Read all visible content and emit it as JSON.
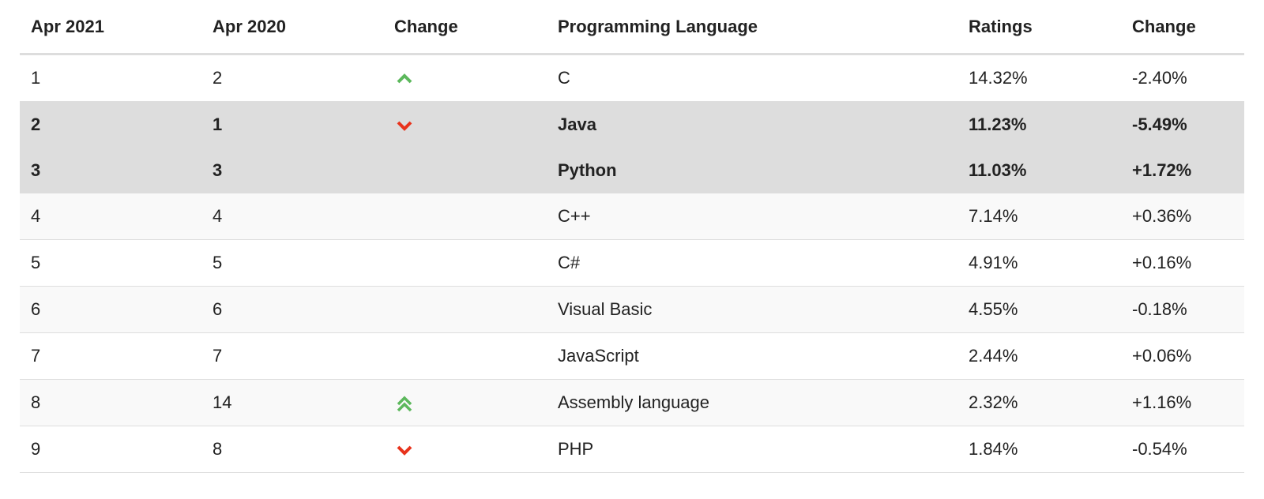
{
  "headers": [
    "Apr 2021",
    "Apr 2020",
    "Change",
    "Programming Language",
    "Ratings",
    "Change"
  ],
  "colors": {
    "up": "#5cb85c",
    "down": "#e8331c",
    "highlight": "#dddddd"
  },
  "rows": [
    {
      "apr2021": "1",
      "apr2020": "2",
      "change_icon": "chevron-up-icon",
      "language": "C",
      "ratings": "14.32%",
      "change": "-2.40%",
      "style": ""
    },
    {
      "apr2021": "2",
      "apr2020": "1",
      "change_icon": "chevron-down-icon",
      "language": "Java",
      "ratings": "11.23%",
      "change": "-5.49%",
      "style": "hl"
    },
    {
      "apr2021": "3",
      "apr2020": "3",
      "change_icon": "",
      "language": "Python",
      "ratings": "11.03%",
      "change": "+1.72%",
      "style": "hl"
    },
    {
      "apr2021": "4",
      "apr2020": "4",
      "change_icon": "",
      "language": "C++",
      "ratings": "7.14%",
      "change": "+0.36%",
      "style": "alt"
    },
    {
      "apr2021": "5",
      "apr2020": "5",
      "change_icon": "",
      "language": "C#",
      "ratings": "4.91%",
      "change": "+0.16%",
      "style": ""
    },
    {
      "apr2021": "6",
      "apr2020": "6",
      "change_icon": "",
      "language": "Visual Basic",
      "ratings": "4.55%",
      "change": "-0.18%",
      "style": "alt"
    },
    {
      "apr2021": "7",
      "apr2020": "7",
      "change_icon": "",
      "language": "JavaScript",
      "ratings": "2.44%",
      "change": "+0.06%",
      "style": ""
    },
    {
      "apr2021": "8",
      "apr2020": "14",
      "change_icon": "double-chevron-up-icon",
      "language": "Assembly language",
      "ratings": "2.32%",
      "change": "+1.16%",
      "style": "alt"
    },
    {
      "apr2021": "9",
      "apr2020": "8",
      "change_icon": "chevron-down-icon",
      "language": "PHP",
      "ratings": "1.84%",
      "change": "-0.54%",
      "style": ""
    }
  ]
}
